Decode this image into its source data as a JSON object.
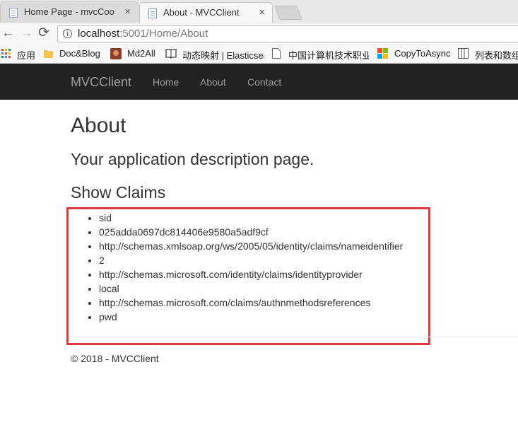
{
  "browser": {
    "tabs": [
      {
        "title": "Home Page - mvcCookieAuthSample",
        "close": "×"
      },
      {
        "title": "About - MVCClient",
        "close": "×"
      }
    ],
    "nav": {
      "back": "←",
      "forward": "→",
      "reload": "⟳"
    },
    "address": {
      "host": "localhost",
      "rest": ":5001/Home/About",
      "info": "i"
    },
    "bookmarks": [
      {
        "label": "应用",
        "icon": "apps-grid-icon"
      },
      {
        "label": "Doc&Blog",
        "icon": "folder-icon"
      },
      {
        "label": "Md2All",
        "icon": "md2all-icon"
      },
      {
        "label": "动态映射 | Elasticsearch",
        "icon": "book-icon"
      },
      {
        "label": "中国计算机技术职业",
        "icon": "page-icon"
      },
      {
        "label": "CopyToAsync",
        "icon": "windows-logo-icon"
      },
      {
        "label": "列表和数组",
        "icon": "list-icon"
      }
    ]
  },
  "site": {
    "brand": "MVCClient",
    "nav": [
      "Home",
      "About",
      "Contact"
    ]
  },
  "page": {
    "title": "About",
    "lead": "Your application description page.",
    "claims_heading": "Show Claims",
    "claims": [
      "sid",
      "025adda0697dc814406e9580a5adf9cf",
      "http://schemas.xmlsoap.org/ws/2005/05/identity/claims/nameidentifier",
      "2",
      "http://schemas.microsoft.com/identity/claims/identityprovider",
      "local",
      "http://schemas.microsoft.com/claims/authnmethodsreferences",
      "pwd"
    ],
    "footer": "© 2018 - MVCClient"
  },
  "colors": {
    "highlight": "#e03b3b",
    "navbar": "#222222"
  }
}
